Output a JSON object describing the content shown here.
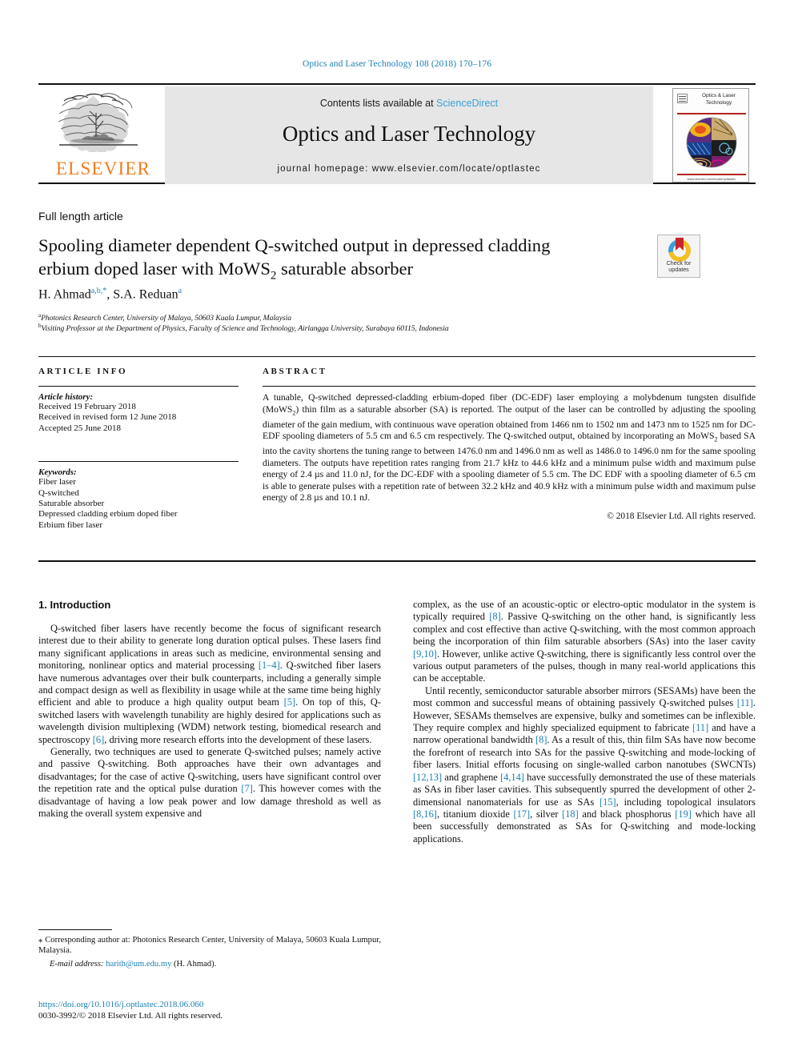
{
  "running_head": "Optics and Laser Technology 108 (2018) 170–176",
  "masthead": {
    "publisher": "ELSEVIER",
    "contents_prefix": "Contents lists available at ",
    "contents_link": "ScienceDirect",
    "journal_title": "Optics and Laser Technology",
    "homepage": "journal homepage: www.elsevier.com/locate/optlastec",
    "cover_title": "Optics & Laser Technology",
    "cover_caption": "www.elsevier.com/locate/optlastec"
  },
  "article": {
    "kind": "Full length article",
    "title_line1": "Spooling diameter dependent Q-switched output in depressed cladding",
    "title_line2_a": "erbium doped laser with MoWS",
    "title_sub": "2",
    "title_line2_b": " saturable absorber",
    "crossmark_line1": "Check for",
    "crossmark_line2": "updates",
    "authors_1": "H. Ahmad",
    "authors_1_sup": "a,b,*",
    "authors_2": ", S.A. Reduan",
    "authors_2_sup": "a",
    "affiliation_a_sup": "a",
    "affiliation_a": "Photonics Research Center, University of Malaya, 50603 Kuala Lumpur, Malaysia",
    "affiliation_b_sup": "b",
    "affiliation_b": "Visiting Professor at the Department of Physics, Faculty of Science and Technology, Airlangga University, Surabaya 60115, Indonesia"
  },
  "info": {
    "heading": "ARTICLE INFO",
    "history_label": "Article history:",
    "history": [
      "Received 19 February 2018",
      "Received in revised form 12 June 2018",
      "Accepted 25 June 2018"
    ],
    "keywords_label": "Keywords:",
    "keywords": [
      "Fiber laser",
      "Q-switched",
      "Saturable absorber",
      "Depressed cladding erbium doped fiber",
      "Erbium fiber laser"
    ]
  },
  "abstract": {
    "heading": "ABSTRACT",
    "part1": "A tunable, Q-switched depressed-cladding erbium-doped fiber (DC-EDF) laser employing a molybdenum tungsten disulfide (MoWS",
    "sub1": "2",
    "part2": ") thin film as a saturable absorber (SA) is reported. The output of the laser can be controlled by adjusting the spooling diameter of the gain medium, with continuous wave operation obtained from 1466 nm to 1502 nm and 1473 nm to 1525 nm for DC-EDF spooling diameters of 5.5 cm and 6.5 cm respectively. The Q-switched output, obtained by incorporating an MoWS",
    "sub2": "2",
    "part3": " based SA into the cavity shortens the tuning range to between 1476.0 nm and 1496.0 nm as well as 1486.0 to 1496.0 nm for the same spooling diameters. The outputs have repetition rates ranging from 21.7 kHz to 44.6 kHz and a minimum pulse width and maximum pulse energy of 2.4 µs and 11.0 nJ, for the DC-EDF with a spooling diameter of 5.5 cm. The DC EDF with a spooling diameter of 6.5 cm is able to generate pulses with a repetition rate of between 32.2 kHz and 40.9 kHz with a minimum pulse width and maximum pulse energy of 2.8 µs and 10.1 nJ.",
    "copyright": "© 2018 Elsevier Ltd. All rights reserved."
  },
  "body": {
    "section_heading": "1. Introduction",
    "left_p1_a": "Q-switched fiber lasers have recently become the focus of significant research interest due to their ability to generate long duration optical pulses. These lasers find many significant applications in areas such as medicine, environmental sensing and monitoring, nonlinear optics and material processing ",
    "left_p1_r1": "[1–4]",
    "left_p1_b": ". Q-switched fiber lasers have numerous advantages over their bulk counterparts, including a generally simple and compact design as well as flexibility in usage while at the same time being highly efficient and able to produce a high quality output beam ",
    "left_p1_r2": "[5]",
    "left_p1_c": ". On top of this, Q-switched lasers with wavelength tunability are highly desired for applications such as wavelength division multiplexing (WDM) network testing, biomedical research and spectroscopy ",
    "left_p1_r3": "[6]",
    "left_p1_d": ", driving more research efforts into the development of these lasers.",
    "left_p2_a": "Generally, two techniques are used to generate Q-switched pulses; namely active and passive Q-switching. Both approaches have their own advantages and disadvantages; for the case of active Q-switching, users have significant control over the repetition rate and the optical pulse duration ",
    "left_p2_r1": "[7]",
    "left_p2_b": ". This however comes with the disadvantage of having a low peak power and low damage threshold as well as making the overall system expensive and",
    "right_p1_a": "complex, as the use of an acoustic-optic or electro-optic modulator in the system is typically required ",
    "right_p1_r1": "[8]",
    "right_p1_b": ". Passive Q-switching on the other hand, is significantly less complex and cost effective than active Q-switching, with the most common approach being the incorporation of thin film saturable absorbers (SAs) into the laser cavity ",
    "right_p1_r2": "[9,10]",
    "right_p1_c": ". However, unlike active Q-switching, there is significantly less control over the various output parameters of the pulses, though in many real-world applications this can be acceptable.",
    "right_p2_a": "Until recently, semiconductor saturable absorber mirrors (SESAMs) have been the most common and successful means of obtaining passively Q-switched pulses ",
    "right_p2_r1": "[11]",
    "right_p2_b": ". However, SESAMs themselves are expensive, bulky and sometimes can be inflexible. They require complex and highly specialized equipment to fabricate ",
    "right_p2_r2": "[11]",
    "right_p2_c": " and have a narrow operational bandwidth ",
    "right_p2_r3": "[8]",
    "right_p2_d": ". As a result of this, thin film SAs have now become the forefront of research into SAs for the passive Q-switching and mode-locking of fiber lasers. Initial efforts focusing on single-walled carbon nanotubes (SWCNTs) ",
    "right_p2_r4": "[12,13]",
    "right_p2_e": " and graphene ",
    "right_p2_r5": "[4,14]",
    "right_p2_f": " have successfully demonstrated the use of these materials as SAs in fiber laser cavities. This subsequently spurred the development of other 2-dimensional nanomaterials for use as SAs ",
    "right_p2_r6": "[15]",
    "right_p2_g": ", including topological insulators ",
    "right_p2_r7": "[8,16]",
    "right_p2_h": ", titanium dioxide ",
    "right_p2_r8": "[17]",
    "right_p2_i": ", silver ",
    "right_p2_r9": "[18]",
    "right_p2_j": " and black phosphorus ",
    "right_p2_r10": "[19]",
    "right_p2_k": " which have all been successfully demonstrated as SAs for Q-switching and mode-locking applications."
  },
  "footnote": {
    "star": "⁎",
    "corresponding": " Corresponding author at: Photonics Research Center, University of Malaya, 50603 Kuala Lumpur, Malaysia.",
    "email_label": "E-mail address:",
    "email": "harith@um.edu.my",
    "email_suffix": " (H. Ahmad).",
    "doi": "https://doi.org/10.1016/j.optlastec.2018.06.060",
    "issn_line": "0030-3992/© 2018 Elsevier Ltd. All rights reserved."
  },
  "colors": {
    "link": "#1b7fb5",
    "elsevier_orange": "#f07c1e",
    "sciencedirect": "#3aa0d8",
    "panel_grey": "#e6e6e6"
  }
}
